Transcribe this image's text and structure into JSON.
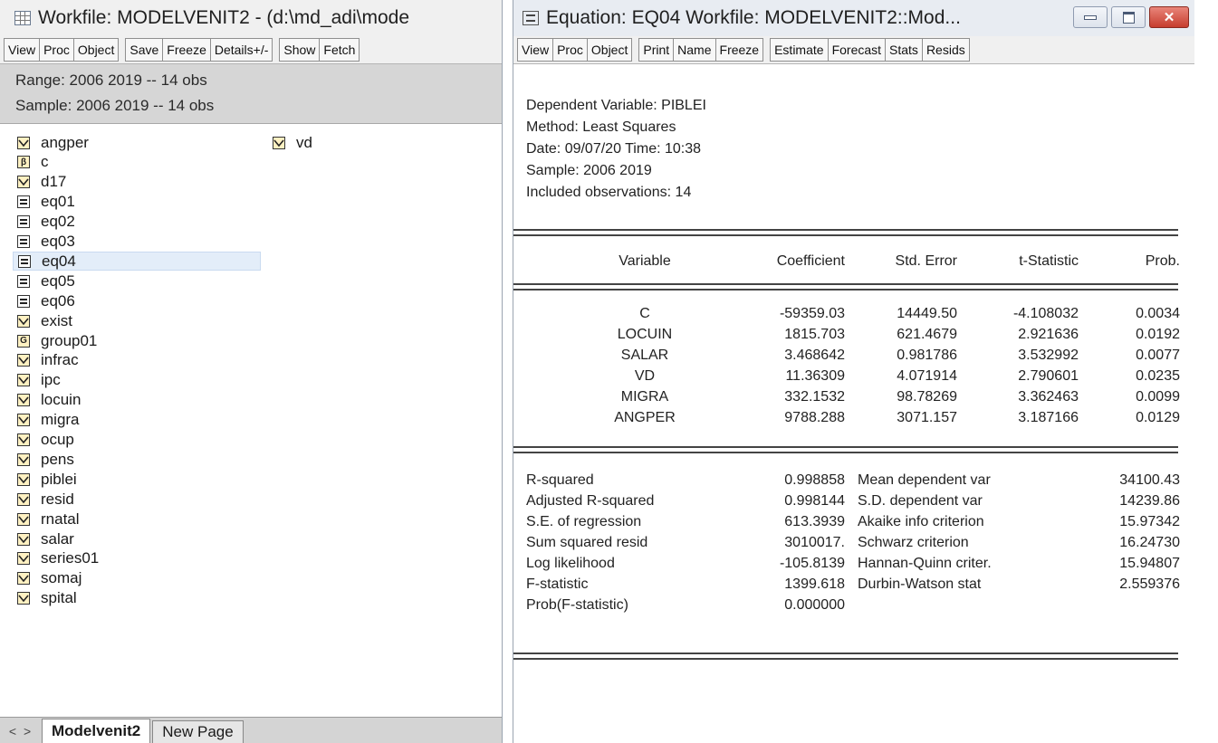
{
  "workfile": {
    "title": "Workfile: MODELVENIT2 - (d:\\md_adi\\mode",
    "toolbar": [
      "View",
      "Proc",
      "Object",
      "Save",
      "Freeze",
      "Details+/-",
      "Show",
      "Fetch"
    ],
    "range": "Range:  2006 2019  --  14 obs",
    "sample": "Sample: 2006 2019  --  14 obs",
    "objects": [
      {
        "name": "angper",
        "icon": "series-icon"
      },
      {
        "name": "c",
        "icon": "coef-icon"
      },
      {
        "name": "d17",
        "icon": "series-icon"
      },
      {
        "name": "eq01",
        "icon": "equation-icon"
      },
      {
        "name": "eq02",
        "icon": "equation-icon"
      },
      {
        "name": "eq03",
        "icon": "equation-icon"
      },
      {
        "name": "eq04",
        "icon": "equation-icon",
        "selected": true
      },
      {
        "name": "eq05",
        "icon": "equation-icon"
      },
      {
        "name": "eq06",
        "icon": "equation-icon"
      },
      {
        "name": "exist",
        "icon": "series-icon"
      },
      {
        "name": "group01",
        "icon": "group-icon"
      },
      {
        "name": "infrac",
        "icon": "series-icon"
      },
      {
        "name": "ipc",
        "icon": "series-icon"
      },
      {
        "name": "locuin",
        "icon": "series-icon"
      },
      {
        "name": "migra",
        "icon": "series-icon"
      },
      {
        "name": "ocup",
        "icon": "series-icon"
      },
      {
        "name": "pens",
        "icon": "series-icon"
      },
      {
        "name": "piblei",
        "icon": "series-icon"
      },
      {
        "name": "resid",
        "icon": "series-icon"
      },
      {
        "name": "rnatal",
        "icon": "series-icon"
      },
      {
        "name": "salar",
        "icon": "series-icon"
      },
      {
        "name": "series01",
        "icon": "series-icon"
      },
      {
        "name": "somaj",
        "icon": "series-icon"
      },
      {
        "name": "spital",
        "icon": "series-icon"
      },
      {
        "name": "vd",
        "icon": "series-icon"
      }
    ],
    "tabs": [
      "Modelvenit2",
      "New Page"
    ],
    "nav": "< >"
  },
  "equation": {
    "title": "Equation: EQ04   Workfile: MODELVENIT2::Mod...",
    "toolbar": [
      "View",
      "Proc",
      "Object",
      "Print",
      "Name",
      "Freeze",
      "Estimate",
      "Forecast",
      "Stats",
      "Resids"
    ],
    "header": [
      "Dependent Variable: PIBLEI",
      "Method: Least Squares",
      "Date: 09/07/20   Time: 10:38",
      "Sample: 2006 2019",
      "Included observations: 14"
    ],
    "columns": [
      "Variable",
      "Coefficient",
      "Std. Error",
      "t-Statistic",
      "Prob."
    ],
    "rows": [
      [
        "C",
        "-59359.03",
        "14449.50",
        "-4.108032",
        "0.0034"
      ],
      [
        "LOCUIN",
        "1815.703",
        "621.4679",
        "2.921636",
        "0.0192"
      ],
      [
        "SALAR",
        "3.468642",
        "0.981786",
        "3.532992",
        "0.0077"
      ],
      [
        "VD",
        "11.36309",
        "4.071914",
        "2.790601",
        "0.0235"
      ],
      [
        "MIGRA",
        "332.1532",
        "98.78269",
        "3.362463",
        "0.0099"
      ],
      [
        "ANGPER",
        "9788.288",
        "3071.157",
        "3.187166",
        "0.0129"
      ]
    ],
    "stats": [
      [
        "R-squared",
        "0.998858",
        "Mean dependent var",
        "34100.43"
      ],
      [
        "Adjusted R-squared",
        "0.998144",
        "S.D. dependent var",
        "14239.86"
      ],
      [
        "S.E. of regression",
        "613.3939",
        "Akaike info criterion",
        "15.97342"
      ],
      [
        "Sum squared resid",
        "3010017.",
        "Schwarz criterion",
        "16.24730"
      ],
      [
        "Log likelihood",
        "-105.8139",
        "Hannan-Quinn criter.",
        "15.94807"
      ],
      [
        "F-statistic",
        "1399.618",
        "Durbin-Watson stat",
        "2.559376"
      ],
      [
        "Prob(F-statistic)",
        "0.000000",
        "",
        ""
      ]
    ]
  }
}
